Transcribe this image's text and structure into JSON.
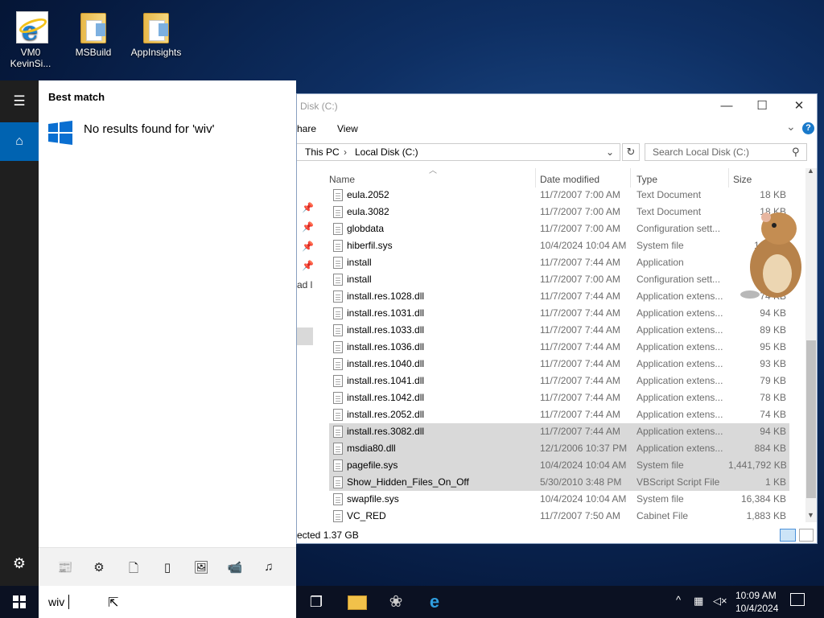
{
  "desktop": {
    "icons": [
      {
        "label": "VM0 KevinSi...",
        "icon": "internet-explorer-icon"
      },
      {
        "label": "MSBuild",
        "icon": "folder-icon"
      },
      {
        "label": "AppInsights",
        "icon": "folder-icon"
      }
    ]
  },
  "explorer": {
    "title": "Disk (C:)",
    "window_buttons": {
      "minimize": "—",
      "maximize": "☐",
      "close": "✕"
    },
    "ribbon": {
      "share": "hare",
      "view": "View",
      "expand": "⌄",
      "help": "?"
    },
    "breadcrumb": [
      "This PC",
      "Local Disk (C:)"
    ],
    "breadcrumb_sep": "›",
    "search_placeholder": "Search Local Disk (C:)",
    "columns": {
      "name": "Name",
      "date": "Date modified",
      "type": "Type",
      "size": "Size"
    },
    "nav_partial": {
      "item": "ad l"
    },
    "files": [
      {
        "name": "eula.2052",
        "date": "11/7/2007 7:00 AM",
        "type": "Text Document",
        "size": "18 KB",
        "selected": false
      },
      {
        "name": "eula.3082",
        "date": "11/7/2007 7:00 AM",
        "type": "Text Document",
        "size": "18 KB",
        "selected": false
      },
      {
        "name": "globdata",
        "date": "11/7/2007 7:00 AM",
        "type": "Configuration sett...",
        "size": "",
        "selected": false
      },
      {
        "name": "hiberfil.sys",
        "date": "10/4/2024 10:04 AM",
        "type": "System file",
        "size": "1,677,5",
        "selected": false
      },
      {
        "name": "install",
        "date": "11/7/2007 7:44 AM",
        "type": "Application",
        "size": "",
        "selected": false
      },
      {
        "name": "install",
        "date": "11/7/2007 7:00 AM",
        "type": "Configuration sett...",
        "size": "",
        "selected": false
      },
      {
        "name": "install.res.1028.dll",
        "date": "11/7/2007 7:44 AM",
        "type": "Application extens...",
        "size": "74 KB",
        "selected": false
      },
      {
        "name": "install.res.1031.dll",
        "date": "11/7/2007 7:44 AM",
        "type": "Application extens...",
        "size": "94 KB",
        "selected": false
      },
      {
        "name": "install.res.1033.dll",
        "date": "11/7/2007 7:44 AM",
        "type": "Application extens...",
        "size": "89 KB",
        "selected": false
      },
      {
        "name": "install.res.1036.dll",
        "date": "11/7/2007 7:44 AM",
        "type": "Application extens...",
        "size": "95 KB",
        "selected": false
      },
      {
        "name": "install.res.1040.dll",
        "date": "11/7/2007 7:44 AM",
        "type": "Application extens...",
        "size": "93 KB",
        "selected": false
      },
      {
        "name": "install.res.1041.dll",
        "date": "11/7/2007 7:44 AM",
        "type": "Application extens...",
        "size": "79 KB",
        "selected": false
      },
      {
        "name": "install.res.1042.dll",
        "date": "11/7/2007 7:44 AM",
        "type": "Application extens...",
        "size": "78 KB",
        "selected": false
      },
      {
        "name": "install.res.2052.dll",
        "date": "11/7/2007 7:44 AM",
        "type": "Application extens...",
        "size": "74 KB",
        "selected": false
      },
      {
        "name": "install.res.3082.dll",
        "date": "11/7/2007 7:44 AM",
        "type": "Application extens...",
        "size": "94 KB",
        "selected": true
      },
      {
        "name": "msdia80.dll",
        "date": "12/1/2006 10:37 PM",
        "type": "Application extens...",
        "size": "884 KB",
        "selected": true
      },
      {
        "name": "pagefile.sys",
        "date": "10/4/2024 10:04 AM",
        "type": "System file",
        "size": "1,441,792 KB",
        "selected": true
      },
      {
        "name": "Show_Hidden_Files_On_Off",
        "date": "5/30/2010 3:48 PM",
        "type": "VBScript Script File",
        "size": "1 KB",
        "selected": true
      },
      {
        "name": "swapfile.sys",
        "date": "10/4/2024 10:04 AM",
        "type": "System file",
        "size": "16,384 KB",
        "selected": false
      },
      {
        "name": "VC_RED",
        "date": "11/7/2007 7:50 AM",
        "type": "Cabinet File",
        "size": "1,883 KB",
        "selected": false
      }
    ],
    "status": "ected  1.37 GB"
  },
  "start": {
    "best_match_label": "Best match",
    "no_results": "No results found for 'wiv'",
    "search_query": "wiv",
    "filter_icons": [
      "news-icon",
      "settings-icon",
      "document-icon",
      "tablet-icon",
      "photo-icon",
      "video-icon",
      "music-icon"
    ]
  },
  "taskbar": {
    "time": "10:09 AM",
    "date": "10/4/2024",
    "tray_chevron": "^"
  },
  "colors": {
    "accent": "#0063b1",
    "rail": "#1f1f1f",
    "taskbar": "#0b1122",
    "selection": "#d9d9d9"
  }
}
